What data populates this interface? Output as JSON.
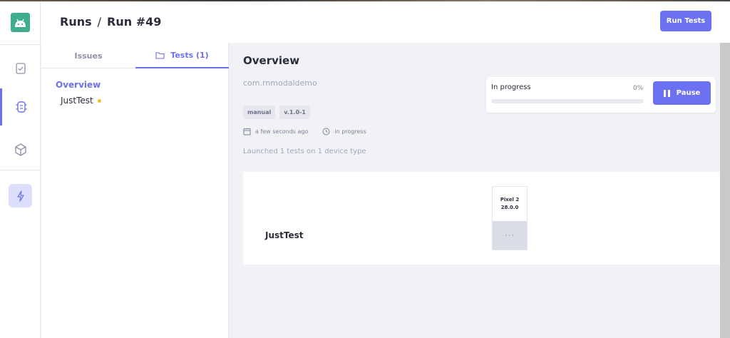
{
  "header": {
    "breadcrumb_root": "Runs",
    "breadcrumb_sep": "/",
    "breadcrumb_current": "Run #49",
    "run_tests_label": "Run Tests"
  },
  "rail": {
    "icons": [
      "android-logo-icon",
      "checklist-icon",
      "chip-icon",
      "cube-icon",
      "lightning-icon"
    ]
  },
  "panel": {
    "tabs": [
      {
        "label": "Issues"
      },
      {
        "label": "Tests (1)"
      }
    ],
    "tree": {
      "overview": "Overview",
      "items": [
        {
          "label": "JustTest",
          "status": "in-progress"
        }
      ]
    }
  },
  "overview": {
    "title": "Overview",
    "package": "com.rnmodaldemo",
    "tags": [
      "manual",
      "v.1.0-1"
    ],
    "time": "a few seconds ago",
    "status": "in progress",
    "launched": "Launched 1 tests on 1 device type"
  },
  "progress": {
    "label": "In progress",
    "percent_label": "0%",
    "value": 0,
    "pause_label": "Pause"
  },
  "results": {
    "test_name": "JustTest",
    "device": {
      "name": "Pixel 2",
      "version": "28.0.0"
    },
    "cell": "···"
  },
  "colors": {
    "accent": "#6b71f0",
    "logo_bg": "#3fae8e",
    "status_dot": "#f5b82e"
  }
}
